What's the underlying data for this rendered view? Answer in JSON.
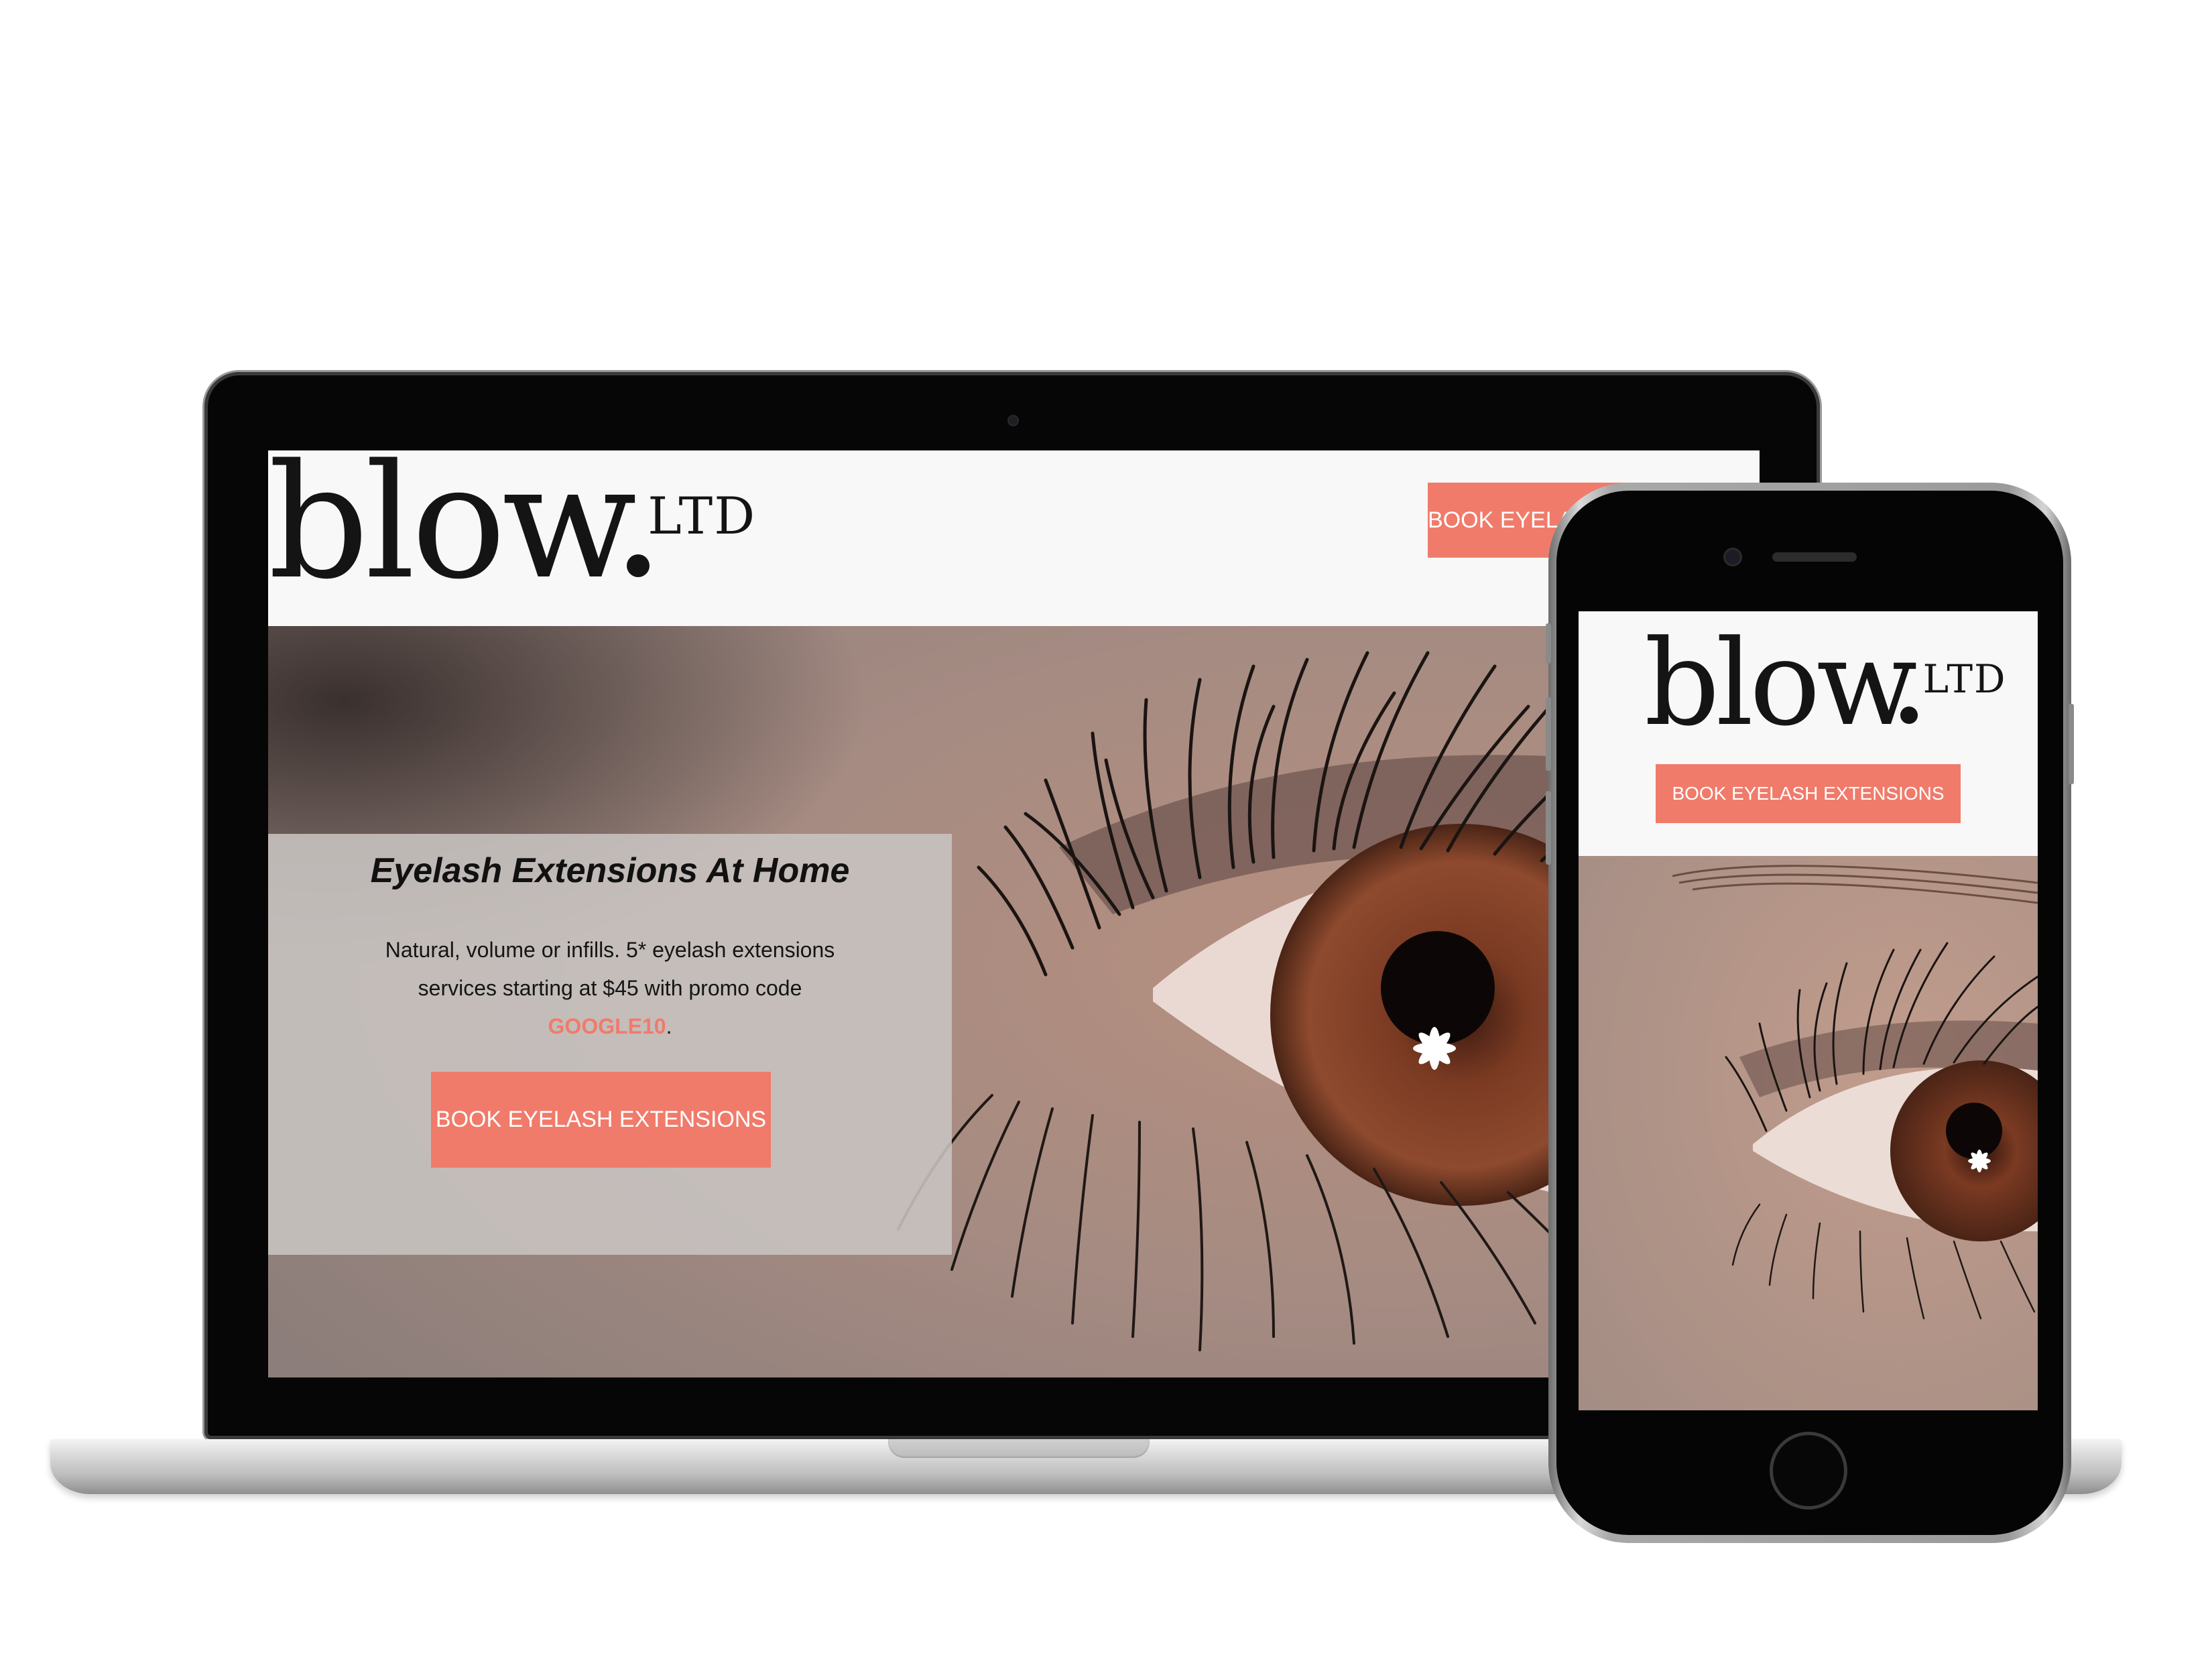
{
  "brand": {
    "logo_word": "blow",
    "logo_suffix": "LTD",
    "accent_color": "#f07b6b"
  },
  "laptop": {
    "header": {
      "cta_label": "BOOK EYELASH EXTENSIONS"
    },
    "promo": {
      "title": "Eyelash Extensions At Home",
      "body_before_code": "Natural, volume or infills. 5* eyelash extensions services starting at $45 with promo code ",
      "promo_code": "GOOGLE10",
      "body_after_code": ".",
      "cta_label": "BOOK EYELASH EXTENSIONS"
    }
  },
  "phone": {
    "header": {
      "cta_label": "BOOK EYELASH EXTENSIONS"
    }
  },
  "icons": {
    "laptop_camera": "camera-icon",
    "phone_camera": "camera-icon",
    "phone_speaker": "speaker-icon",
    "phone_home": "home-button-icon"
  }
}
